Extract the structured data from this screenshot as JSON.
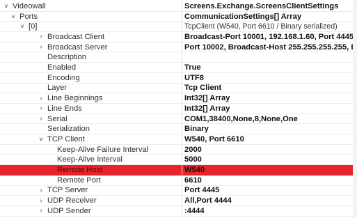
{
  "rows": [
    {
      "name": "Videowall",
      "value": "Screens.Exchange.ScreensClientSettings",
      "chev": "open",
      "level": 0,
      "bold": true
    },
    {
      "name": "Ports",
      "value": "CommunicationSettings[] Array",
      "chev": "open",
      "level": 1,
      "bold": true
    },
    {
      "name": "[0]",
      "value": "TcpClient (W540, Port 6610 / Binary serialized)",
      "chev": "open",
      "level": 2,
      "bold": false
    },
    {
      "name": "Broadcast Client",
      "value": "Broadcast-Port 10001, 192.168.1.60, Port 4445",
      "chev": "closed",
      "level": 3,
      "bold": true
    },
    {
      "name": "Broadcast Server",
      "value": "Port 10002, Broadcast-Host 255.255.255.255, E",
      "chev": "closed",
      "level": 3,
      "bold": true
    },
    {
      "name": "Description",
      "value": "",
      "chev": "none",
      "level": 3,
      "bold": true
    },
    {
      "name": "Enabled",
      "value": "True",
      "chev": "none",
      "level": 3,
      "bold": true
    },
    {
      "name": "Encoding",
      "value": "UTF8",
      "chev": "none",
      "level": 3,
      "bold": true
    },
    {
      "name": "Layer",
      "value": "Tcp Client",
      "chev": "none",
      "level": 3,
      "bold": true
    },
    {
      "name": "Line Beginnings",
      "value": "Int32[] Array",
      "chev": "closed",
      "level": 3,
      "bold": true
    },
    {
      "name": "Line Ends",
      "value": "Int32[] Array",
      "chev": "closed",
      "level": 3,
      "bold": true
    },
    {
      "name": "Serial",
      "value": "COM1,38400,None,8,None,One",
      "chev": "closed",
      "level": 3,
      "bold": true
    },
    {
      "name": "Serialization",
      "value": "Binary",
      "chev": "none",
      "level": 3,
      "bold": true
    },
    {
      "name": "TCP Client",
      "value": "W540, Port 6610",
      "chev": "open",
      "level": 3,
      "bold": true
    },
    {
      "name": "Keep-Alive Failure Interval",
      "value": "2000",
      "chev": "none",
      "level": 4,
      "bold": true
    },
    {
      "name": "Keep-Alive Interval",
      "value": "5000",
      "chev": "none",
      "level": 4,
      "bold": true
    },
    {
      "name": "Remote Host",
      "value": "W540",
      "chev": "none",
      "level": 4,
      "bold": true,
      "selected": true
    },
    {
      "name": "Remote Port",
      "value": "6610",
      "chev": "none",
      "level": 4,
      "bold": true
    },
    {
      "name": "TCP Server",
      "value": "Port 4445",
      "chev": "closed",
      "level": 3,
      "bold": true
    },
    {
      "name": "UDP Receiver",
      "value": "All,Port 4444",
      "chev": "closed",
      "level": 3,
      "bold": true
    },
    {
      "name": "UDP Sender",
      "value": ":4444",
      "chev": "closed",
      "level": 3,
      "bold": true
    }
  ],
  "icons": {
    "expanded": "chevron-down-icon",
    "collapsed": "chevron-right-icon"
  }
}
